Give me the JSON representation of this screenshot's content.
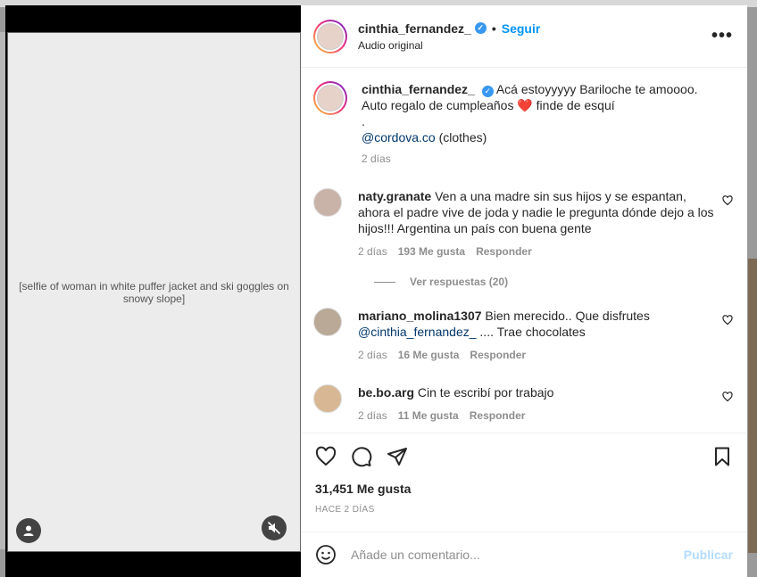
{
  "post": {
    "username": "cinthia_fernandez_",
    "follow_label": "Seguir",
    "dot": "•",
    "audio": "Audio original",
    "more_label": "•••",
    "media_label": "[selfie of woman in white puffer jacket and ski goggles on snowy slope]"
  },
  "caption": {
    "username": "cinthia_fernandez_",
    "line1": "Acá estoyyyyy Bariloche te amoooo.",
    "line2": "Auto regalo de cumpleaños ❤️ finde de esquí",
    "line3": ".",
    "mention": "@cordova.co",
    "mention_suffix": " (clothes)",
    "time": "2 días"
  },
  "comments": [
    {
      "username": "naty.granate",
      "text": "Ven a una madre sin sus hijos y se espantan, ahora el padre vive de joda y nadie le pregunta dónde dejo a los hijos!!! Argentina un país con buena gente",
      "time": "2 días",
      "likes": "193 Me gusta",
      "reply": "Responder",
      "avatar_color": "#c9b2a8"
    },
    {
      "username": "mariano_molina1307",
      "text": "Bien merecido.. Que disfrutes",
      "mention": "@cinthia_fernandez_",
      "text2": ".... Trae chocolates",
      "time": "2 días",
      "likes": "16 Me gusta",
      "reply": "Responder",
      "avatar_color": "#b9a996"
    },
    {
      "username": "be.bo.arg",
      "text": "Cin te escribí por trabajo",
      "time": "2 días",
      "likes": "11 Me gusta",
      "reply": "Responder",
      "avatar_color": "#d8b894"
    }
  ],
  "view_replies": "Ver respuestas (20)",
  "likes_count": "31,451 Me gusta",
  "timestamp": "HACE 2 DÍAS",
  "add_comment": {
    "placeholder": "Añade un comentario...",
    "post_label": "Publicar"
  },
  "colors": {
    "accent": "#0095f6",
    "verified": "#3897f0",
    "muted": "#8e8e8e"
  }
}
